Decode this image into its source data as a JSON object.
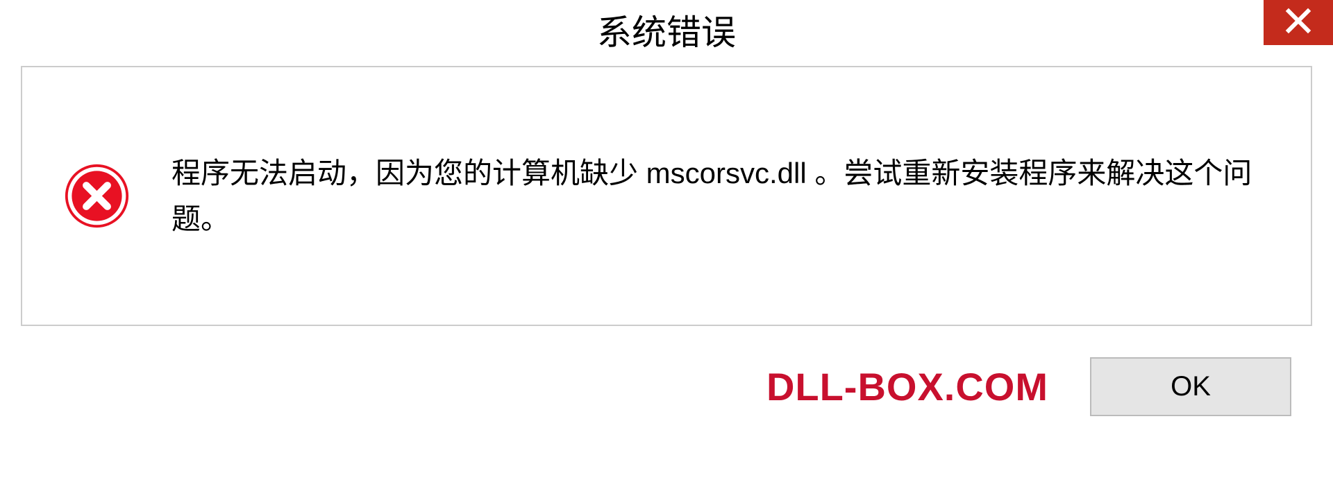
{
  "title": "系统错误",
  "message": "程序无法启动，因为您的计算机缺少 mscorsvc.dll 。尝试重新安装程序来解决这个问题。",
  "watermark": "DLL-BOX.COM",
  "ok_button": "OK",
  "colors": {
    "close_bg": "#c42b1c",
    "error_icon": "#e81123",
    "watermark": "#c8102e"
  }
}
